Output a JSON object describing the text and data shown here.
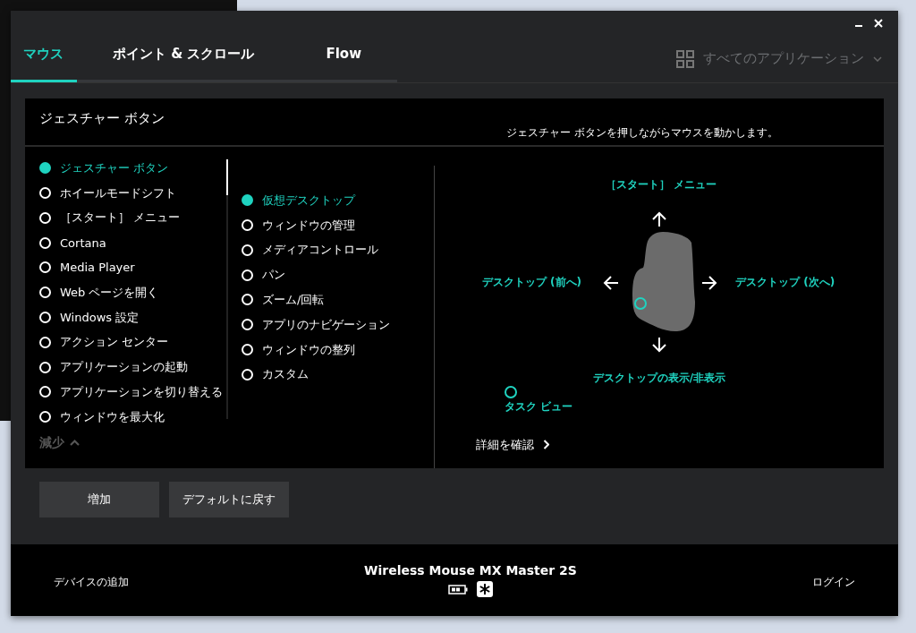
{
  "tabs": [
    {
      "label": "マウス",
      "selected": true
    },
    {
      "label": "ポイント & スクロール",
      "selected": false
    },
    {
      "label": "Flow",
      "selected": false
    }
  ],
  "app_selector": {
    "label": "すべてのアプリケーション",
    "disabled": true
  },
  "panel": {
    "title": "ジェスチャー ボタン",
    "description": "ジェスチャー ボタンを押しながらマウスを動かします。"
  },
  "buttons_list": [
    {
      "label": "ジェスチャー ボタン",
      "selected": true
    },
    {
      "label": "ホイールモードシフト",
      "selected": false
    },
    {
      "label": "［スタート］ メニュー",
      "selected": false
    },
    {
      "label": "Cortana",
      "selected": false
    },
    {
      "label": "Media Player",
      "selected": false
    },
    {
      "label": "Web ページを開く",
      "selected": false
    },
    {
      "label": "Windows 設定",
      "selected": false
    },
    {
      "label": "アクション センター",
      "selected": false
    },
    {
      "label": "アプリケーションの起動",
      "selected": false
    },
    {
      "label": "アプリケーションを切り替える",
      "selected": false
    },
    {
      "label": "ウィンドウを最大化",
      "selected": false
    }
  ],
  "collapse": "減少",
  "actions": [
    {
      "label": "仮想デスクトップ",
      "selected": true
    },
    {
      "label": "ウィンドウの管理",
      "selected": false
    },
    {
      "label": "メディアコントロール",
      "selected": false
    },
    {
      "label": "パン",
      "selected": false
    },
    {
      "label": "ズーム/回転",
      "selected": false
    },
    {
      "label": "アプリのナビゲーション",
      "selected": false
    },
    {
      "label": "ウィンドウの整列",
      "selected": false
    },
    {
      "label": "カスタム",
      "selected": false
    }
  ],
  "gesture": {
    "up": "［スタート］ メニュー",
    "left": "デスクトップ (前へ)",
    "right": "デスクトップ (次へ)",
    "down": "デスクトップの表示/非表示",
    "click": "タスク ビュー"
  },
  "details_link": "詳細を確認",
  "bottom_buttons": [
    "増加",
    "デフォルトに戻す"
  ],
  "footer": {
    "add_device": "デバイスの追加",
    "device_name": "Wireless Mouse MX Master 2S",
    "login": "ログイン"
  }
}
